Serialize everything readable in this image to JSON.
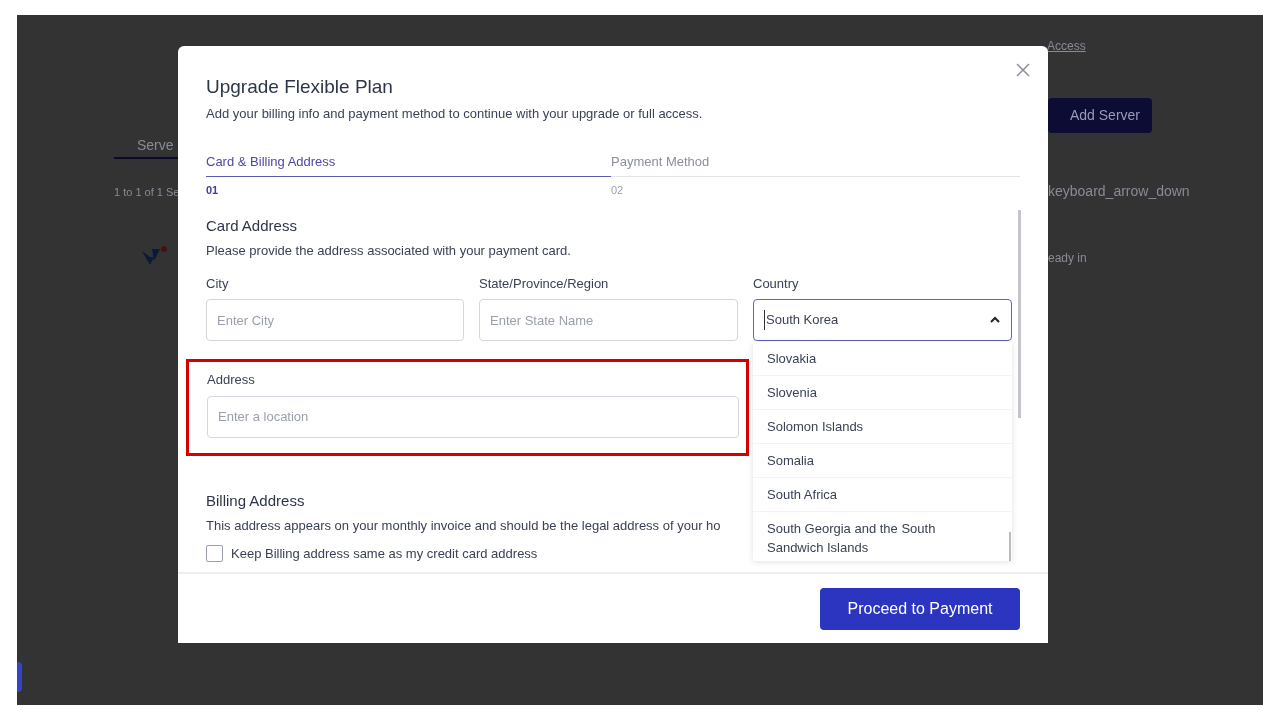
{
  "background": {
    "banner_link": "Access",
    "tab_label": "Serve",
    "count_text": "1 to 1 of 1 Se",
    "add_server_button": "Add Server",
    "sort_text": "keyboard_arrow_down",
    "status_text": "eady in"
  },
  "dialog": {
    "title": "Upgrade Flexible Plan",
    "subtitle": "Add your billing info and payment method to continue with your upgrade or full access.",
    "steps": [
      {
        "label": "Card & Billing Address",
        "number": "01",
        "selected": true
      },
      {
        "label": "Payment Method",
        "number": "02",
        "selected": false
      }
    ],
    "card_address": {
      "heading": "Card Address",
      "description": "Please provide the address associated with your payment card.",
      "fields": [
        {
          "label": "City",
          "placeholder": "Enter City"
        },
        {
          "label": "State/Province/Region",
          "placeholder": "Enter State Name"
        }
      ],
      "country": {
        "label": "Country",
        "value": "South Korea",
        "expanded": true,
        "options": [
          "Slovakia",
          "Slovenia",
          "Solomon Islands",
          "Somalia",
          "South Africa",
          "South Georgia and the South Sandwich Islands"
        ]
      },
      "address": {
        "label": "Address",
        "placeholder": "Enter a location",
        "highlighted": true
      }
    },
    "billing_address": {
      "heading": "Billing Address",
      "description": "This address appears on your monthly invoice and should be the legal address of your ho",
      "checkbox": {
        "label": "Keep Billing address same as my credit card address",
        "checked": false
      }
    },
    "primary_button": "Proceed to Payment"
  }
}
